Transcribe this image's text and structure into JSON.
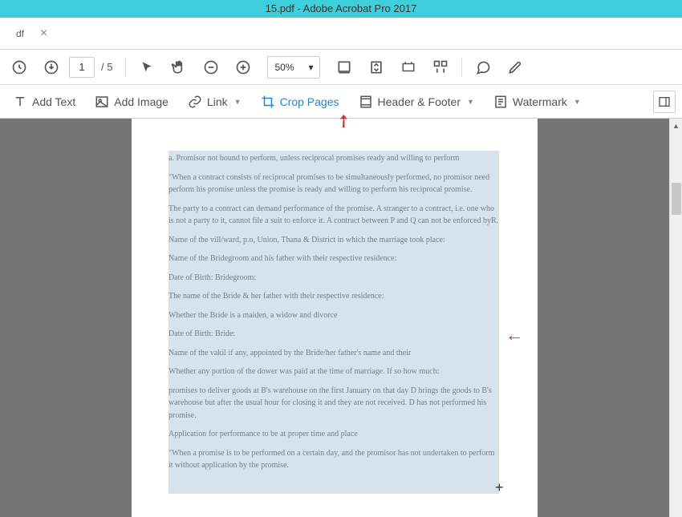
{
  "title": "15.pdf - Adobe Acrobat Pro 2017",
  "tab": {
    "name": "df",
    "close": "×"
  },
  "page_nav": {
    "current": "1",
    "total": "/ 5"
  },
  "zoom": {
    "value": "50%",
    "caret": "▾"
  },
  "tools": {
    "add_text": "Add Text",
    "add_image": "Add Image",
    "link": "Link",
    "crop_pages": "Crop Pages",
    "header_footer": "Header & Footer",
    "watermark": "Watermark"
  },
  "document": {
    "p1": "a. Promisor not bound to perform, unless reciprocal promises ready and willing to perform",
    "p2": "\"When a contract consists of reciprocal promises to be simultaneously performed, no promisor need perform his promise unless the promise is ready and willing to perform his reciprocal promise.",
    "p3": "The party to a contract can demand performance of the promise. A stranger to a contract, i.e. one who is not a party to it, cannot file a suit to enforce it. A contract between P and Q can not be enforced byR.",
    "p4": "Name of the vill/ward, p.o, Union, Thana & District in which the marriage took place:",
    "p5": "Name of the Bridegroom and his father with their respective residence:",
    "p6": "Date of Birth: Bridegroom:",
    "p7": "The name of the Bride & her father with their respective residence:",
    "p8": "Whether the Bride is a maiden, a widow and divorce",
    "p9": "Date of Birth: Bride:",
    "p10": "Name of the vakil if any, appointed by the Bride/her father's name and their",
    "p11": "Whether any portion of the dower was paid at the time of marriage. If so how much:",
    "p12": "promises to deliver goods at B's warehouse on the first January on that day D brings the goods to B's warehouse but after the usual hour for closing it and they are not received. D has not performed his promise.",
    "p13": "Application for performance to be at proper time and place",
    "p14": "\"When a promise is to be performed on a certain day, and the promisor has not undertaken to perform it without application by the promise."
  }
}
